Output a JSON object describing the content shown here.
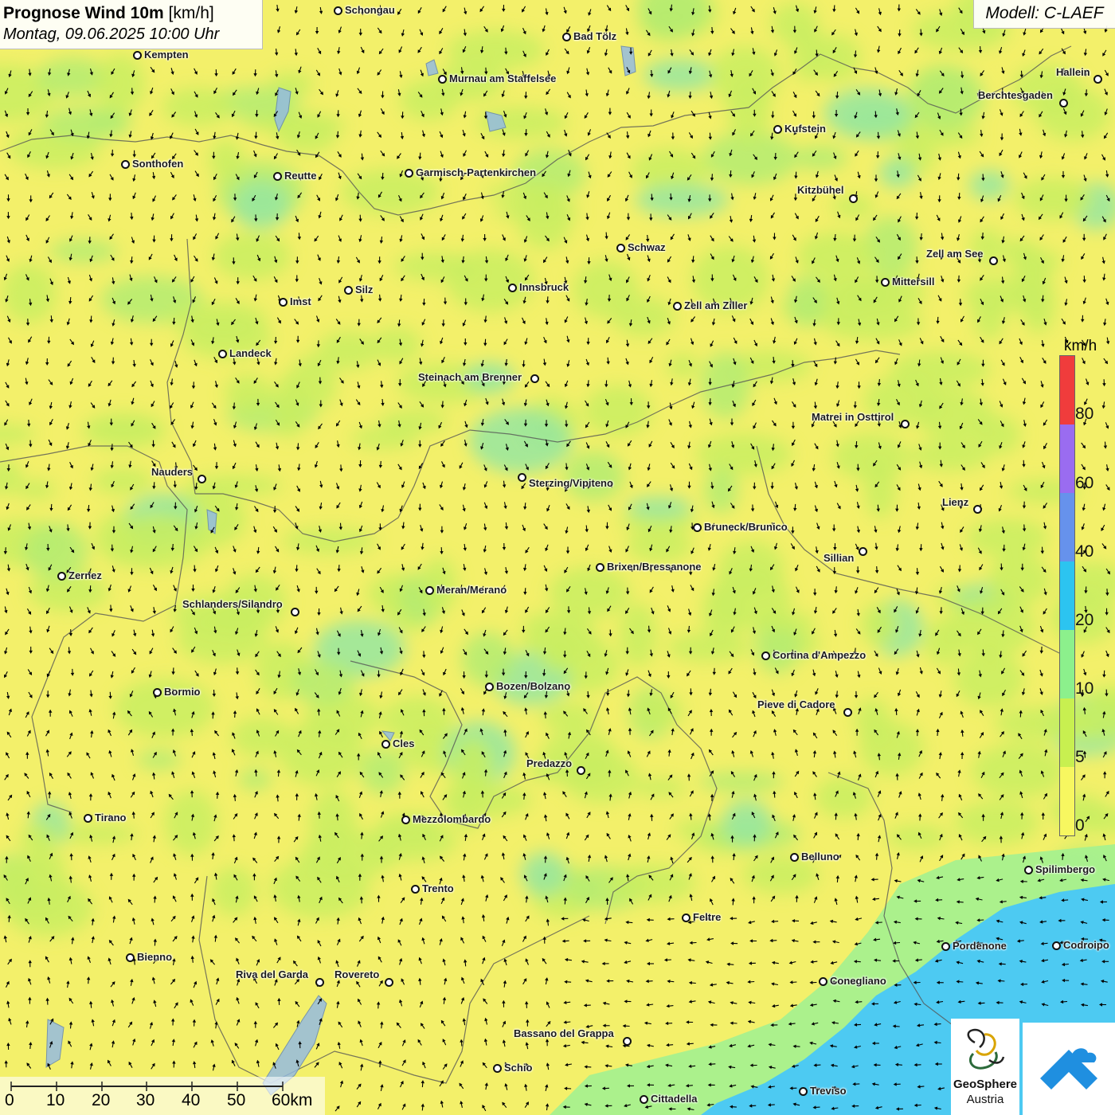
{
  "header": {
    "title_main": "Prognose Wind 10m",
    "title_unit": "[km/h]",
    "datetime": "Montag, 09.06.2025 10:00 Uhr"
  },
  "model_label": "Modell: C-LAEF",
  "legend": {
    "unit": "km/h",
    "ticks": [
      "80",
      "60",
      "40",
      "20",
      "10",
      "5",
      "0"
    ],
    "colors": [
      "#f03c3c",
      "#9a6cf0",
      "#6692ec",
      "#2cc4f0",
      "#8cf08c",
      "#c8f050",
      "#f7f760"
    ]
  },
  "cities": [
    {
      "name": "Schongau"
    },
    {
      "name": "Bad Tölz"
    },
    {
      "name": "Kempten"
    },
    {
      "name": "Murnau am Staffelsee"
    },
    {
      "name": "Hallein"
    },
    {
      "name": "Berchtesgaden"
    },
    {
      "name": "Kufstein"
    },
    {
      "name": "Sonthofen"
    },
    {
      "name": "Reutte"
    },
    {
      "name": "Garmisch-Partenkirchen"
    },
    {
      "name": "Kitzbühel"
    },
    {
      "name": "Schwaz"
    },
    {
      "name": "Zell am See"
    },
    {
      "name": "Innsbruck"
    },
    {
      "name": "Mittersill"
    },
    {
      "name": "Silz"
    },
    {
      "name": "Imst"
    },
    {
      "name": "Zell am Ziller"
    },
    {
      "name": "Landeck"
    },
    {
      "name": "Steinach am Brenner"
    },
    {
      "name": "Matrei in Osttirol"
    },
    {
      "name": "Nauders"
    },
    {
      "name": "Sterzing/Vipiteno"
    },
    {
      "name": "Lienz"
    },
    {
      "name": "Bruneck/Brunico"
    },
    {
      "name": "Sillian"
    },
    {
      "name": "Brixen/Bressanone"
    },
    {
      "name": "Zernez"
    },
    {
      "name": "Meran/Merano"
    },
    {
      "name": "Schlanders/Silandro"
    },
    {
      "name": "Cortina d'Ampezzo"
    },
    {
      "name": "Bozen/Bolzano"
    },
    {
      "name": "Bormio"
    },
    {
      "name": "Pieve di Cadore"
    },
    {
      "name": "Cles"
    },
    {
      "name": "Predazzo"
    },
    {
      "name": "Tirano"
    },
    {
      "name": "Mezzolombardo"
    },
    {
      "name": "Belluno"
    },
    {
      "name": "Spilimbergo"
    },
    {
      "name": "Trento"
    },
    {
      "name": "Feltre"
    },
    {
      "name": "Pordenone"
    },
    {
      "name": "Codroipo"
    },
    {
      "name": "Bienno"
    },
    {
      "name": "Riva del Garda"
    },
    {
      "name": "Rovereto"
    },
    {
      "name": "Conegliano"
    },
    {
      "name": "Bassano del Grappa"
    },
    {
      "name": "Schio"
    },
    {
      "name": "Treviso"
    },
    {
      "name": "Cittadella"
    }
  ],
  "scale_bar": {
    "labels": [
      "0",
      "10",
      "20",
      "30",
      "40",
      "50",
      "60km"
    ]
  },
  "logos": {
    "geosphere_line1": "GeoSphere",
    "geosphere_line2": "Austria"
  }
}
